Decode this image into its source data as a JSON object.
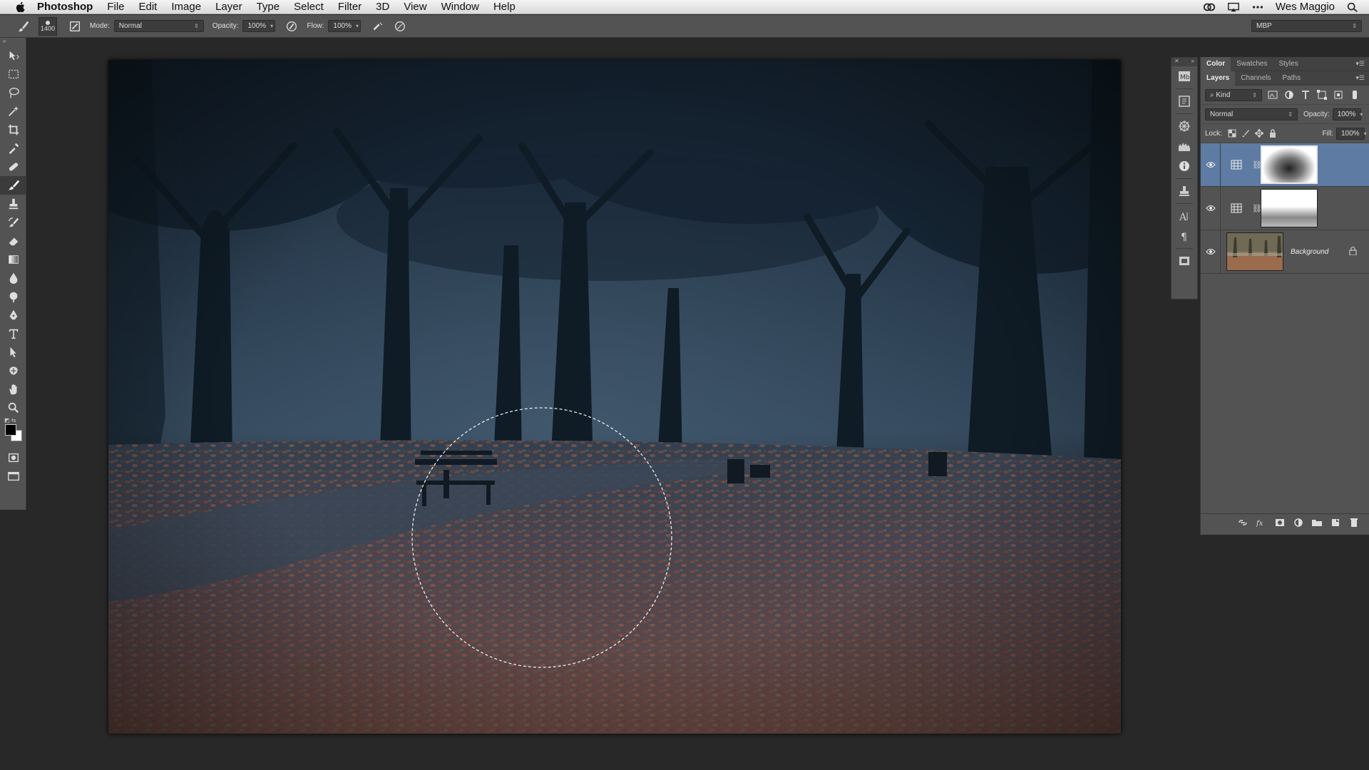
{
  "menubar": {
    "app_name": "Photoshop",
    "items": [
      "File",
      "Edit",
      "Image",
      "Layer",
      "Type",
      "Select",
      "Filter",
      "3D",
      "View",
      "Window",
      "Help"
    ],
    "user": "Wes Maggio"
  },
  "options_bar": {
    "brush_size": "1400",
    "mode_label": "Mode:",
    "mode_value": "Normal",
    "opacity_label": "Opacity:",
    "opacity_value": "100%",
    "flow_label": "Flow:",
    "flow_value": "100%",
    "workspace": "MBP"
  },
  "tools": [
    {
      "name": "move",
      "icon": "move-tool-icon"
    },
    {
      "name": "marquee",
      "icon": "rect-marquee-icon"
    },
    {
      "name": "lasso",
      "icon": "lasso-icon"
    },
    {
      "name": "magic-wand",
      "icon": "magic-wand-icon"
    },
    {
      "name": "crop",
      "icon": "crop-icon"
    },
    {
      "name": "eyedropper",
      "icon": "eyedropper-icon"
    },
    {
      "name": "healing",
      "icon": "healing-brush-icon"
    },
    {
      "name": "brush",
      "icon": "brush-icon",
      "active": true
    },
    {
      "name": "stamp",
      "icon": "clone-stamp-icon"
    },
    {
      "name": "history-brush",
      "icon": "history-brush-icon"
    },
    {
      "name": "eraser",
      "icon": "eraser-icon"
    },
    {
      "name": "gradient",
      "icon": "gradient-icon"
    },
    {
      "name": "blur",
      "icon": "blur-icon"
    },
    {
      "name": "dodge",
      "icon": "dodge-icon"
    },
    {
      "name": "pen",
      "icon": "pen-icon"
    },
    {
      "name": "type",
      "icon": "type-icon"
    },
    {
      "name": "path-select",
      "icon": "path-select-icon"
    },
    {
      "name": "shape",
      "icon": "custom-shape-icon"
    },
    {
      "name": "hand",
      "icon": "hand-icon"
    },
    {
      "name": "zoom",
      "icon": "zoom-icon"
    }
  ],
  "panels": {
    "top_tabs": [
      "Color",
      "Swatches",
      "Styles"
    ],
    "layer_tabs": [
      "Layers",
      "Channels",
      "Paths"
    ],
    "filter_kind": "Kind",
    "blend_mode": "Normal",
    "opacity_label": "Opacity:",
    "opacity_value": "100%",
    "lock_label": "Lock:",
    "fill_label": "Fill:",
    "fill_value": "100%",
    "layers": [
      {
        "name": "",
        "type": "adjustment",
        "selected": true
      },
      {
        "name": "",
        "type": "adjustment",
        "selected": false
      },
      {
        "name": "Background",
        "type": "image",
        "locked": true
      }
    ]
  },
  "colors": {
    "chrome": "#535353",
    "canvas_bg": "#282828",
    "selection_blue": "#5d7ba3",
    "foreground": "#000000",
    "background": "#ffffff"
  }
}
